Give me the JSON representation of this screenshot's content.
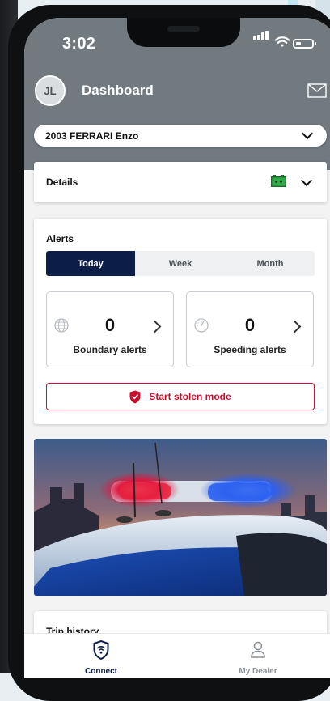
{
  "status_bar": {
    "time": "3:02"
  },
  "header": {
    "avatar_initials": "JL",
    "title": "Dashboard",
    "mail_icon": "mail-icon"
  },
  "vehicle_selector": {
    "value": "2003 FERRARI Enzo",
    "icon": "chevron-down-icon"
  },
  "details": {
    "label": "Details",
    "battery_icon": "battery-icon",
    "battery_color": "#2eab46"
  },
  "alerts": {
    "label": "Alerts",
    "tabs": [
      "Today",
      "Week",
      "Month"
    ],
    "active_tab": "Today",
    "boundary": {
      "count": "0",
      "label": "Boundary alerts",
      "icon": "globe-icon"
    },
    "speeding": {
      "count": "0",
      "label": "Speeding alerts",
      "icon": "speedometer-icon"
    },
    "stolen_button": {
      "label": "Start stolen mode",
      "icon": "shield-icon"
    }
  },
  "trip_history": {
    "label": "Trip history"
  },
  "tab_bar": {
    "connect": {
      "label": "Connect",
      "icon": "connect-icon"
    },
    "my_dealer": {
      "label": "My Dealer",
      "icon": "person-icon"
    }
  },
  "colors": {
    "accent_navy": "#0c1d47",
    "alert_red": "#c8102e",
    "header_gray": "#727a7f"
  }
}
